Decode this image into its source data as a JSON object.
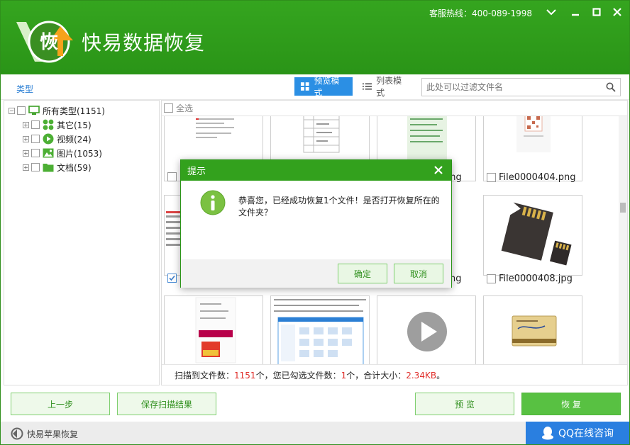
{
  "app": {
    "title": "快易数据恢复",
    "logo_text": "恢",
    "hotline": "客服热线：400-089-1998"
  },
  "toolbar": {
    "type_label": "类型",
    "preview_mode": "预览模式",
    "list_mode": "列表模式",
    "filter_placeholder": "此处可以过滤文件名"
  },
  "tree": {
    "root": "所有类型(1151)",
    "items": [
      {
        "label": "其它(15)",
        "icon": "grid-dots-icon",
        "color": "#4caf34"
      },
      {
        "label": "视频(24)",
        "icon": "play-circle-icon",
        "color": "#4caf34"
      },
      {
        "label": "图片(1053)",
        "icon": "image-icon",
        "color": "#4caf34"
      },
      {
        "label": "文档(59)",
        "icon": "folder-icon",
        "color": "#4caf34"
      }
    ]
  },
  "content": {
    "select_all": "全选",
    "files": [
      {
        "name": "png"
      },
      {
        "name": "File0000404.png"
      },
      {
        "name": "ng"
      },
      {
        "name": "File0000408.jpg"
      }
    ]
  },
  "status": {
    "prefix": "扫描到文件数：",
    "scanned": "1151",
    "unit1": "个，您已勾选文件数：",
    "selected": "1",
    "unit2": "个，合计大小：",
    "size": "2.34KB",
    "end": "。"
  },
  "buttons": {
    "prev": "上一步",
    "save": "保存扫描结果",
    "preview": "预 览",
    "recover": "恢 复"
  },
  "footer": {
    "apple": "快易苹果恢复",
    "qq": "QQ在线咨询"
  },
  "dialog": {
    "title": "提示",
    "message": "恭喜您，已经成功恢复1个文件！是否打开恢复所在的文件夹？",
    "ok": "确定",
    "cancel": "取消"
  },
  "colors": {
    "brand_green": "#33a11d",
    "accent_blue": "#2b8fe4",
    "alert_red": "#e0302c"
  }
}
